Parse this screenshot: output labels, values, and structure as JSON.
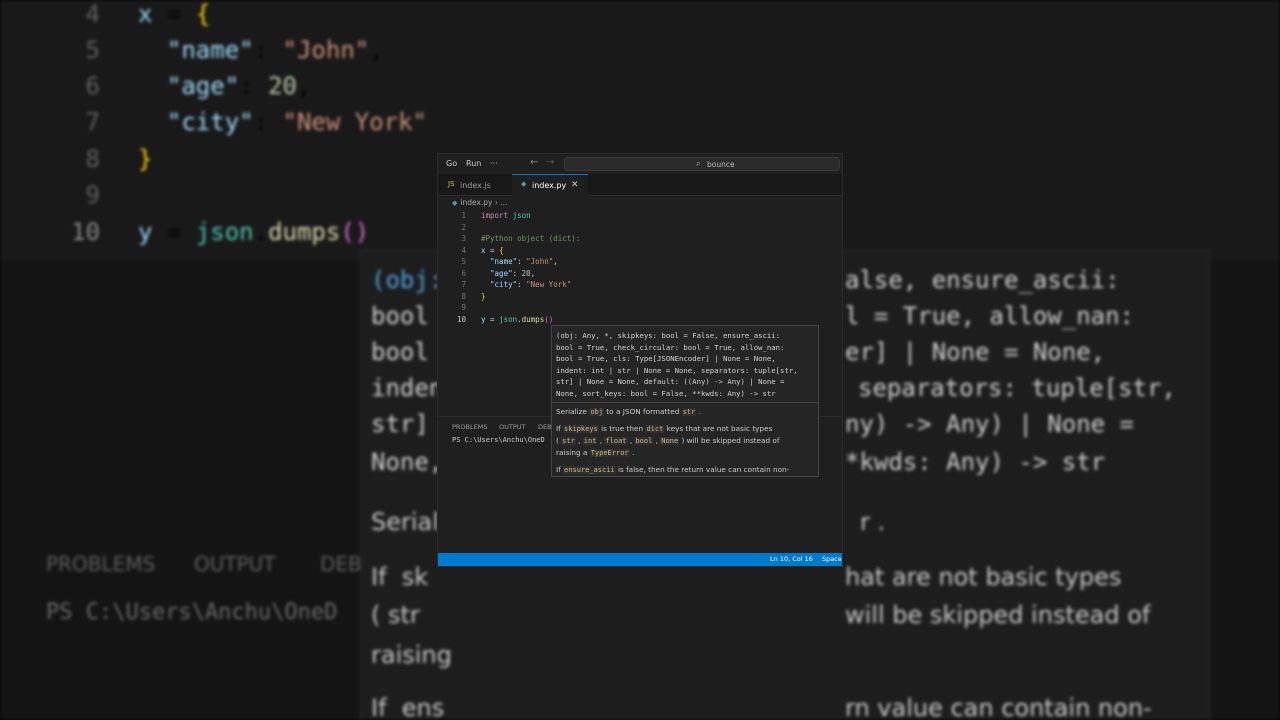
{
  "background": {
    "code_lines": [
      {
        "num": "4",
        "text": "x = {"
      },
      {
        "num": "5",
        "text": "  \"name\": \"John\","
      },
      {
        "num": "6",
        "text": "  \"age\": 20,"
      },
      {
        "num": "7",
        "text": "  \"city\": \"New York\""
      },
      {
        "num": "8",
        "text": "}"
      },
      {
        "num": "9",
        "text": ""
      },
      {
        "num": "10",
        "text": "y = json.dumps()"
      }
    ],
    "hover_lines": [
      "(obj:",
      "bool",
      "bool",
      "inden",
      "str]",
      "None,"
    ],
    "hover_right_lines": [
      "alse, ensure_ascii:",
      "l = True, allow_nan:",
      "er] | None = None,",
      "separators: tuple[str,",
      "ny) -> Any) | None =",
      "*kwds: Any) -> str"
    ],
    "doc_left": [
      "Seriali",
      "If  sk",
      "( str",
      "raising",
      "If  ens"
    ],
    "doc_right": [
      "r .",
      "hat are not basic types",
      "will be skipped instead of",
      "",
      "rn value can contain non-"
    ],
    "panel_tabs": [
      "PROBLEMS",
      "OUTPUT",
      "DEB"
    ],
    "terminal": "PS C:\\Users\\Anchu\\OneD"
  },
  "window": {
    "menu": [
      "Go",
      "Run",
      "···"
    ],
    "search": "bounce",
    "tabs": [
      {
        "label": "index.js",
        "icon": "JS",
        "active": false
      },
      {
        "label": "index.py",
        "icon": "◆",
        "active": true
      }
    ],
    "close_glyph": "✕",
    "breadcrumb": {
      "file": "index.py",
      "sep": "›",
      "rest": "..."
    },
    "lines": [
      "1",
      "2",
      "3",
      "4",
      "5",
      "6",
      "7",
      "8",
      "9",
      "10"
    ],
    "code": {
      "l1_kw": "import",
      "l1_mod": "json",
      "l3": "#Python object (dict):",
      "l4_var": "x",
      "l4_op": " = ",
      "l4_br": "{",
      "l5_key": "\"name\"",
      "l5_val": "\"John\"",
      "l6_key": "\"age\"",
      "l6_val": "20",
      "l7_key": "\"city\"",
      "l7_val": "\"New York\"",
      "l8_br": "}",
      "l10_var": "y",
      "l10_op": " = ",
      "l10_mod": "json",
      "l10_fn": "dumps",
      "l10_par": "()"
    },
    "panel_tabs": [
      "PROBLEMS",
      "OUTPUT",
      "DEB"
    ],
    "terminal": "PS C:\\Users\\Anchu\\OneD",
    "status": {
      "position": "Ln 10, Col 16",
      "spaces": "Space"
    }
  },
  "hover": {
    "sig_lines": [
      "obj: Any, *, skipkeys: bool = False, ensure_ascii:",
      "bool = True, check_circular: bool = True, allow_nan:",
      "bool = True, cls: Type[JSONEncoder] | None = None,",
      "indent: int | str | None = None, separators: tuple[str,",
      "str] | None = None, default: ((Any) -> Any) | None =",
      "None, sort_keys: bool = False, **kwds: Any) -> str"
    ],
    "doc": {
      "p1_a": "Serialize ",
      "p1_code": "obj",
      "p1_b": " to a JSON formatted ",
      "p1_code2": "str",
      "p1_c": " .",
      "p2_a": "If ",
      "p2_code": "skipkeys",
      "p2_b": " is true then ",
      "p2_code2": "dict",
      "p2_c": " keys that are not basic types",
      "p3_a": "( ",
      "p3_c1": "str",
      "p3_c2": "int",
      "p3_c3": "float",
      "p3_c4": "bool",
      "p3_c5": "None",
      "p3_b": " ) will be skipped instead of",
      "p4_a": "raising a ",
      "p4_code": "TypeError",
      "p4_b": " .",
      "p5_a": "If ",
      "p5_code": "ensure_ascii",
      "p5_b": " is false, then the return value can contain non-"
    }
  }
}
